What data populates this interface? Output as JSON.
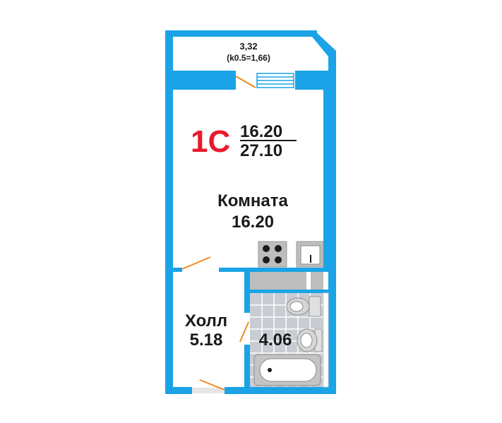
{
  "plan": {
    "type_code": "1С",
    "living_area": "16.20",
    "total_area": "27.10",
    "colors": {
      "wall": "#1aa3e6",
      "accent": "#e8192c",
      "door_arc": "#f08a1c",
      "tile": "#d9d9d9",
      "fixture": "#bdbdbd"
    }
  },
  "rooms": {
    "loggia": {
      "area": "3,32",
      "coef": "(k0.5=1,66)"
    },
    "living": {
      "name": "Комната",
      "area": "16.20"
    },
    "hall": {
      "name": "Холл",
      "area": "5.18"
    },
    "bath": {
      "area": "4.06"
    }
  },
  "icons": [
    "stove-icon",
    "sink-icon",
    "toilet-icon",
    "washbasin-icon",
    "bathtub-icon",
    "window-icon"
  ]
}
